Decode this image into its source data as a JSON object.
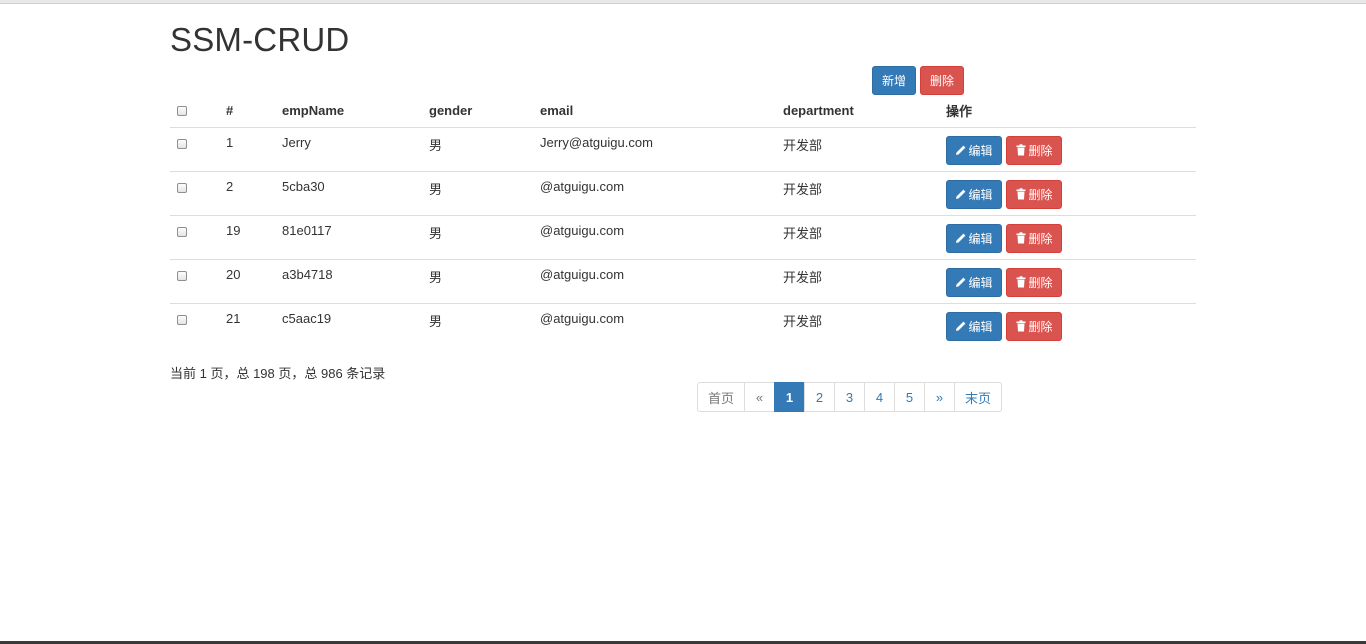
{
  "page": {
    "title": "SSM-CRUD"
  },
  "toolbar": {
    "add_label": "新增",
    "delete_label": "删除"
  },
  "table": {
    "headers": [
      "#",
      "empName",
      "gender",
      "email",
      "department",
      "操作"
    ],
    "rows": [
      {
        "id": "1",
        "name": "Jerry",
        "gender": "男",
        "email": "Jerry@atguigu.com",
        "dept": "开发部"
      },
      {
        "id": "2",
        "name": "5cba30",
        "gender": "男",
        "email": "@atguigu.com",
        "dept": "开发部"
      },
      {
        "id": "19",
        "name": "81e0117",
        "gender": "男",
        "email": "@atguigu.com",
        "dept": "开发部"
      },
      {
        "id": "20",
        "name": "a3b4718",
        "gender": "男",
        "email": "@atguigu.com",
        "dept": "开发部"
      },
      {
        "id": "21",
        "name": "c5aac19",
        "gender": "男",
        "email": "@atguigu.com",
        "dept": "开发部"
      }
    ],
    "edit_label": "编辑",
    "delete_label": "删除"
  },
  "pagination": {
    "info": "当前 1 页，总 198 页，总 986 条记录",
    "first": "首页",
    "prev": "«",
    "pages": [
      "1",
      "2",
      "3",
      "4",
      "5"
    ],
    "next": "»",
    "last": "末页",
    "active_page": "1"
  },
  "colors": {
    "primary": "#337ab7",
    "danger": "#d9534f"
  },
  "icons": {
    "edit": "pencil-icon",
    "delete": "trash-icon"
  }
}
